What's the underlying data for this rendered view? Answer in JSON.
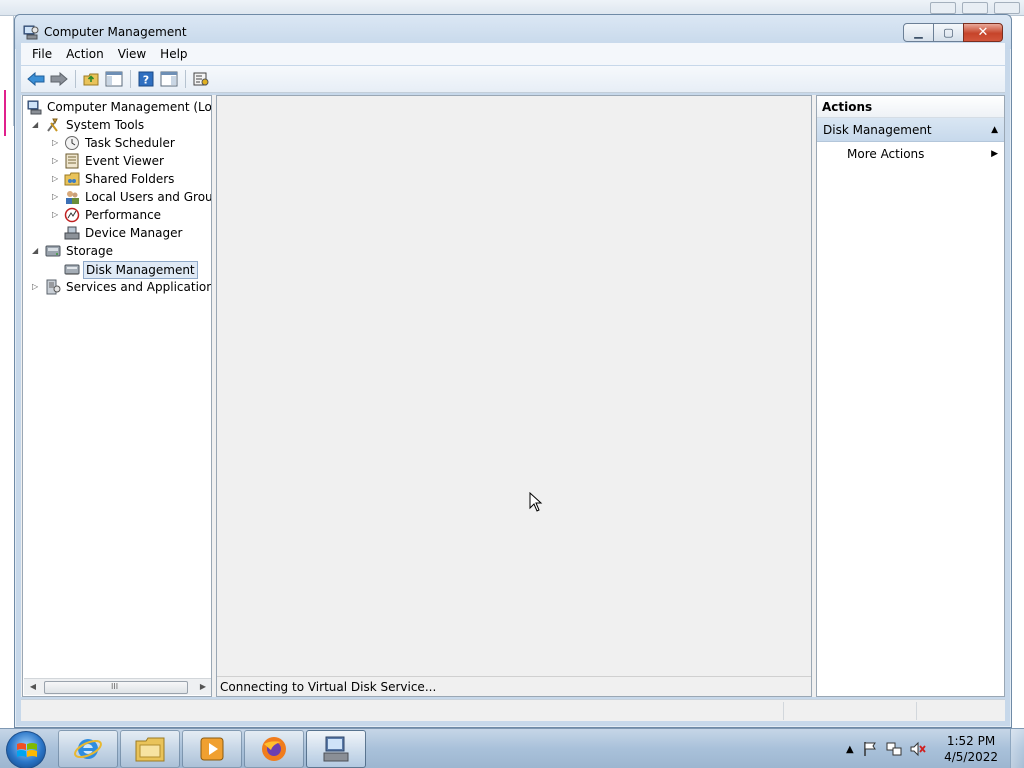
{
  "window": {
    "title": "Computer Management",
    "controls": [
      "minimize",
      "maximize",
      "close"
    ]
  },
  "menu": {
    "items": [
      "File",
      "Action",
      "View",
      "Help"
    ]
  },
  "toolbar": {
    "icons": [
      "back-arrow-icon",
      "forward-arrow-icon",
      "up-folder-icon",
      "show-hide-console-tree-icon",
      "help-icon",
      "show-hide-action-pane-icon",
      "properties-icon"
    ]
  },
  "tree": {
    "items": [
      {
        "label": "Computer Management (Local",
        "level": 0,
        "expander": "none",
        "icon": "computer-management-icon"
      },
      {
        "label": "System Tools",
        "level": 1,
        "expander": "expanded",
        "icon": "system-tools-icon"
      },
      {
        "label": "Task Scheduler",
        "level": 2,
        "expander": "collapsed",
        "icon": "clock-icon"
      },
      {
        "label": "Event Viewer",
        "level": 2,
        "expander": "collapsed",
        "icon": "event-viewer-icon"
      },
      {
        "label": "Shared Folders",
        "level": 2,
        "expander": "collapsed",
        "icon": "shared-folders-icon"
      },
      {
        "label": "Local Users and Groups",
        "level": 2,
        "expander": "collapsed",
        "icon": "users-icon"
      },
      {
        "label": "Performance",
        "level": 2,
        "expander": "collapsed",
        "icon": "performance-icon"
      },
      {
        "label": "Device Manager",
        "level": 2,
        "expander": "none",
        "icon": "device-manager-icon"
      },
      {
        "label": "Storage",
        "level": 1,
        "expander": "expanded",
        "icon": "storage-icon"
      },
      {
        "label": "Disk Management",
        "level": 2,
        "expander": "none",
        "icon": "disk-management-icon",
        "selected": true
      },
      {
        "label": "Services and Applications",
        "level": 1,
        "expander": "collapsed",
        "icon": "services-icon"
      }
    ],
    "scrollbar_grip": "III"
  },
  "center": {
    "status": "Connecting to Virtual Disk Service..."
  },
  "actions": {
    "header": "Actions",
    "section": "Disk Management",
    "items": [
      "More Actions"
    ]
  },
  "taskbar": {
    "apps": [
      "internet-explorer-icon",
      "windows-explorer-icon",
      "media-player-icon",
      "firefox-icon",
      "computer-management-icon"
    ],
    "clock_time": "1:52 PM",
    "clock_date": "4/5/2022"
  },
  "colors": {
    "titlebar": "#c5d7ea",
    "actions_section": "#c7d9ec",
    "selection": "#dfe9f5",
    "close_button": "#c6442a"
  }
}
